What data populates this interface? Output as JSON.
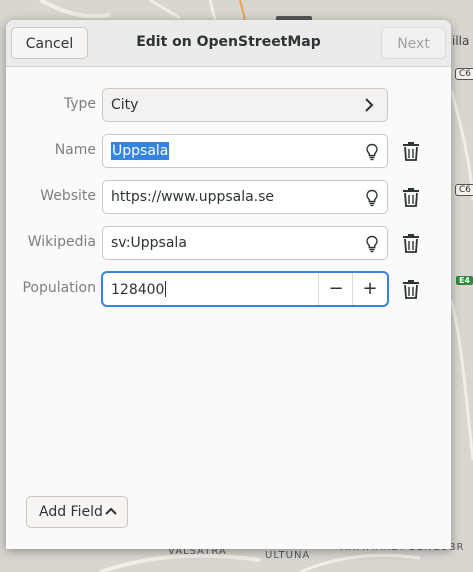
{
  "map": {
    "labels": [
      "VALSÄTRA",
      "ULTUNA",
      "HAMMARBY-BENGSBR"
    ],
    "shields": [
      "C6",
      "C6",
      "E4"
    ],
    "edge_text": "illa"
  },
  "header": {
    "cancel_label": "Cancel",
    "title": "Edit on OpenStreetMap",
    "next_label": "Next"
  },
  "fields": {
    "type": {
      "label": "Type",
      "value": "City"
    },
    "name": {
      "label": "Name",
      "value": "Uppsala"
    },
    "website": {
      "label": "Website",
      "value": "https://www.uppsala.se"
    },
    "wikipedia": {
      "label": "Wikipedia",
      "value": "sv:Uppsala"
    },
    "population": {
      "label": "Population",
      "value": "128400",
      "minus": "−",
      "plus": "+"
    }
  },
  "footer": {
    "add_field_label": "Add Field"
  },
  "colors": {
    "accent": "#3584e4",
    "header_bg": "#ebebeb",
    "dialog_bg": "#fafafa"
  }
}
